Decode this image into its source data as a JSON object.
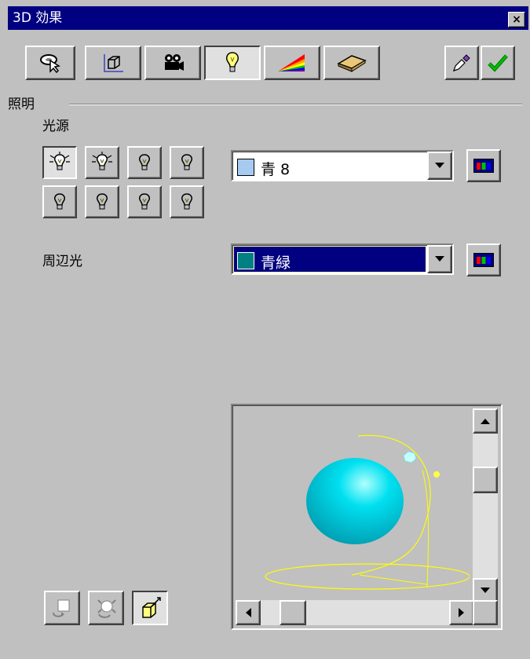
{
  "window": {
    "title": "3D 効果",
    "close_glyph": "×"
  },
  "toolbar": {
    "tabs": [
      {
        "icon": "geometry-icon",
        "active": false
      },
      {
        "icon": "shading-icon",
        "active": false
      },
      {
        "icon": "camera-icon",
        "active": false
      },
      {
        "icon": "lightbulb-icon",
        "active": true
      },
      {
        "icon": "textures-icon",
        "active": false
      },
      {
        "icon": "material-icon",
        "active": false
      }
    ],
    "right_buttons": [
      {
        "icon": "eyedropper-icon"
      },
      {
        "icon": "checkmark-icon"
      }
    ]
  },
  "section": {
    "title": "照明",
    "light_source_label": "光源",
    "ambient_label": "周辺光"
  },
  "light_source_combo": {
    "value": "青 8",
    "swatch_color": "#a6caf0"
  },
  "ambient_combo": {
    "value": "青緑",
    "swatch_color": "#008080"
  },
  "colors": {
    "title_bg": "#000080",
    "face": "#c0c0c0",
    "selection": "#000080",
    "sphere": "#00c8d8",
    "light_path": "#ffff00"
  }
}
